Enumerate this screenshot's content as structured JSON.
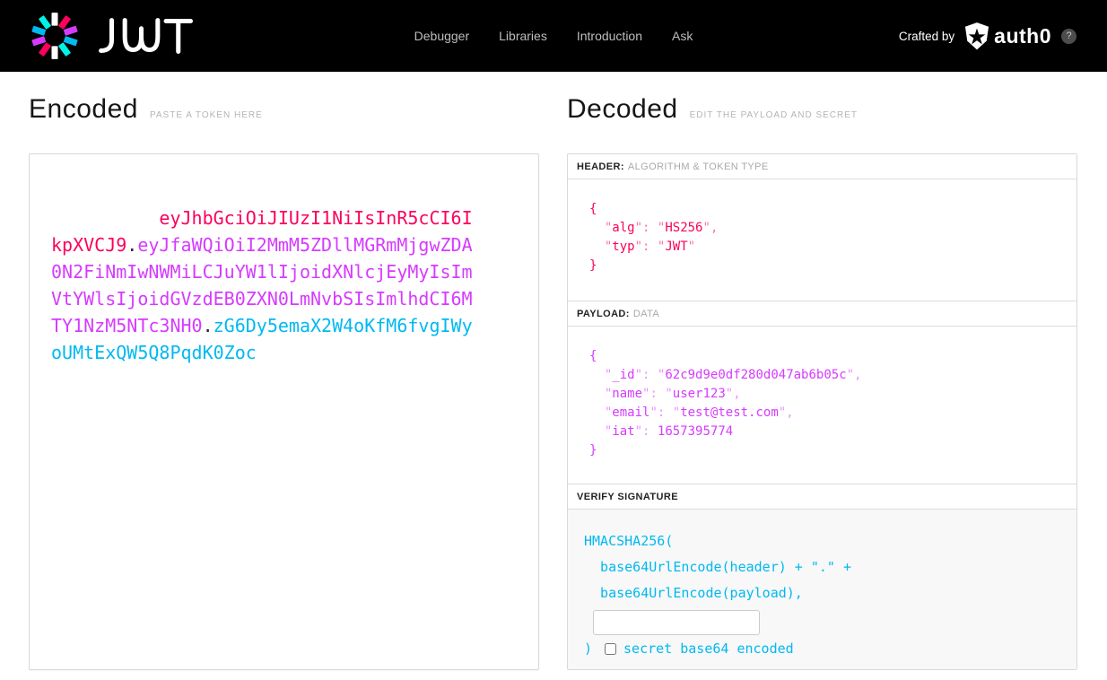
{
  "colors": {
    "navbar_bg": "#000000",
    "encoded_header": "#fb015b",
    "encoded_payload": "#d63aff",
    "encoded_signature": "#00b9f1"
  },
  "nav": {
    "brand": "JWT",
    "items": [
      {
        "label": "Debugger"
      },
      {
        "label": "Libraries"
      },
      {
        "label": "Introduction"
      },
      {
        "label": "Ask"
      }
    ],
    "crafted_by_label": "Crafted by",
    "partner_brand": "auth0",
    "help_label": "?"
  },
  "encoded": {
    "title": "Encoded",
    "subtitle": "PASTE A TOKEN HERE",
    "token": {
      "header": "eyJhbGciOiJIUzI1NiIsInR5cCI6IkpXVCJ9",
      "dot1": ".",
      "payload": "eyJfaWQiOiI2MmM5ZDllMGRmMjgwZDA0N2FiNmIwNWMiLCJuYW1lIjoidXNlcjEyMyIsImVtYWlsIjoidGVzdEB0ZXN0LmNvbSIsImlhdCI6MTY1NzM5NTc3NH0",
      "dot2": ".",
      "signature": "zG6Dy5emaX2W4oKfM6fvgIWyoUMtExQW5Q8PqdK0Zoc"
    }
  },
  "decoded": {
    "title": "Decoded",
    "subtitle": "EDIT THE PAYLOAD AND SECRET",
    "header_section": {
      "label": "HEADER:",
      "sublabel": "ALGORITHM & TOKEN TYPE",
      "json": "{\n  \"alg\": \"HS256\",\n  \"typ\": \"JWT\"\n}"
    },
    "payload_section": {
      "label": "PAYLOAD:",
      "sublabel": "DATA",
      "json": "{\n  \"_id\": \"62c9d9e0df280d047ab6b05c\",\n  \"name\": \"user123\",\n  \"email\": \"test@test.com\",\n  \"iat\": 1657395774\n}"
    },
    "verify_section": {
      "label": "VERIFY SIGNATURE",
      "code_top": "HMACSHA256(\n  base64UrlEncode(header) + \".\" +\n  base64UrlEncode(payload),",
      "secret_value": "",
      "code_close": ")",
      "checkbox_label": "secret base64 encoded"
    }
  }
}
